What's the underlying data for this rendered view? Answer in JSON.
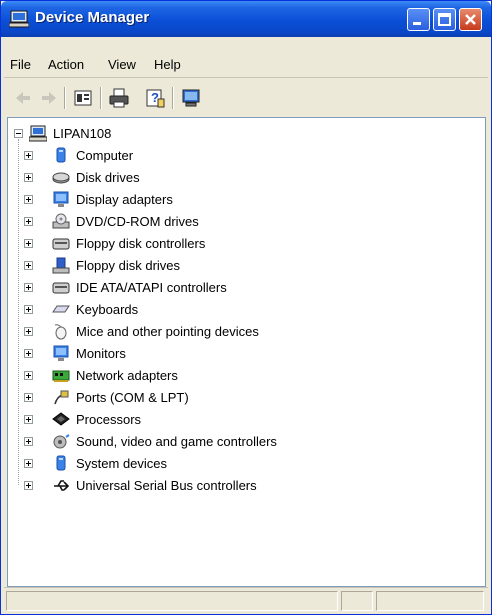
{
  "window": {
    "title": "Device Manager"
  },
  "titlebar_buttons": [
    "minimize-icon",
    "maximize-icon",
    "close-icon"
  ],
  "menu": {
    "items": [
      "File",
      "Action",
      "View",
      "Help"
    ]
  },
  "toolbar": {
    "buttons": [
      "back-arrow-icon",
      "forward-arrow-icon",
      "properties-icon",
      "print-icon",
      "help-icon",
      "device-icon"
    ]
  },
  "tree": {
    "root": "LIPAN108",
    "categories": [
      {
        "label": "Computer",
        "icon": "computer-icon"
      },
      {
        "label": "Disk drives",
        "icon": "disk-drive-icon"
      },
      {
        "label": "Display adapters",
        "icon": "display-adapter-icon"
      },
      {
        "label": "DVD/CD-ROM drives",
        "icon": "dvd-drive-icon"
      },
      {
        "label": "Floppy disk controllers",
        "icon": "floppy-controller-icon"
      },
      {
        "label": "Floppy disk drives",
        "icon": "floppy-drive-icon"
      },
      {
        "label": "IDE ATA/ATAPI controllers",
        "icon": "ide-controller-icon"
      },
      {
        "label": "Keyboards",
        "icon": "keyboard-icon"
      },
      {
        "label": "Mice and other pointing devices",
        "icon": "mouse-icon"
      },
      {
        "label": "Monitors",
        "icon": "monitor-icon"
      },
      {
        "label": "Network adapters",
        "icon": "network-adapter-icon"
      },
      {
        "label": "Ports (COM & LPT)",
        "icon": "port-icon"
      },
      {
        "label": "Processors",
        "icon": "processor-icon"
      },
      {
        "label": "Sound, video and game controllers",
        "icon": "sound-icon"
      },
      {
        "label": "System devices",
        "icon": "system-device-icon"
      },
      {
        "label": "Universal Serial Bus controllers",
        "icon": "usb-icon"
      }
    ]
  },
  "colors": {
    "titlebar": "#0a4fd6",
    "window_frame": "#ece9d8",
    "tree_border": "#7f9db9"
  }
}
